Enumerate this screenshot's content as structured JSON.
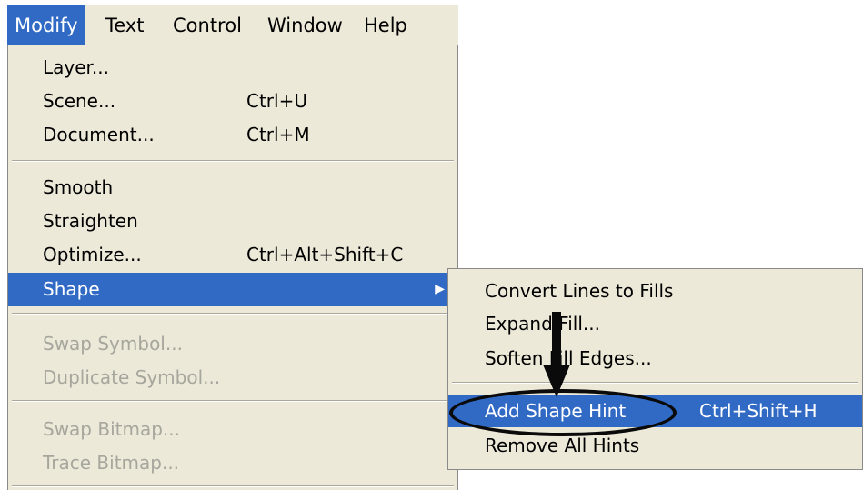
{
  "menubar": {
    "items": [
      {
        "label": "Modify",
        "active": true
      },
      {
        "label": "Text"
      },
      {
        "label": "Control"
      },
      {
        "label": "Window"
      },
      {
        "label": "Help"
      }
    ]
  },
  "modify_menu": {
    "items": [
      {
        "label": "Layer...",
        "shortcut": ""
      },
      {
        "label": "Scene...",
        "shortcut": "Ctrl+U"
      },
      {
        "label": "Document...",
        "shortcut": "Ctrl+M"
      },
      {
        "label": "Smooth",
        "shortcut": ""
      },
      {
        "label": "Straighten",
        "shortcut": ""
      },
      {
        "label": "Optimize...",
        "shortcut": "Ctrl+Alt+Shift+C"
      },
      {
        "label": "Shape",
        "shortcut": "",
        "submenu": true,
        "highlighted": true
      },
      {
        "label": "Swap Symbol...",
        "disabled": true
      },
      {
        "label": "Duplicate Symbol...",
        "disabled": true
      },
      {
        "label": "Swap Bitmap...",
        "disabled": true
      },
      {
        "label": "Trace Bitmap...",
        "disabled": true
      }
    ]
  },
  "shape_submenu": {
    "items": [
      {
        "label": "Convert Lines to Fills",
        "shortcut": ""
      },
      {
        "label": "Expand Fill...",
        "shortcut": ""
      },
      {
        "label": "Soften Fill Edges...",
        "shortcut": ""
      },
      {
        "label": "Add Shape Hint",
        "shortcut": "Ctrl+Shift+H",
        "highlighted": true
      },
      {
        "label": "Remove All Hints",
        "shortcut": ""
      }
    ]
  },
  "colors": {
    "menu_bg": "#ece9d8",
    "highlight": "#316ac5",
    "disabled_text": "#a7a69d"
  },
  "icons": {
    "submenu_arrow": "chevron-right-icon",
    "annotation": "down-arrow-icon"
  }
}
